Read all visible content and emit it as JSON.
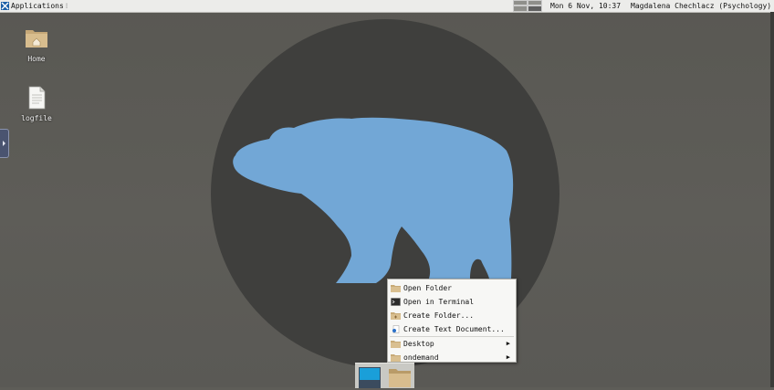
{
  "panel": {
    "applications_label": "Applications",
    "menu_dots": "⁝",
    "clock": "Mon  6 Nov, 10:37",
    "user": "Magdalena Chechlacz (Psychology)"
  },
  "desktop": {
    "icons": [
      {
        "label": "Home",
        "icon": "home-folder-icon"
      },
      {
        "label": "logfile",
        "icon": "text-file-icon"
      }
    ],
    "wallpaper": {
      "circle_color": "#3f3f3d",
      "bear_color": "#72a7d6"
    }
  },
  "context_menu": {
    "items": [
      {
        "label": "Open Folder",
        "icon": "folder-icon"
      },
      {
        "label": "Open in Terminal",
        "icon": "terminal-icon"
      },
      {
        "label": "Create Folder...",
        "icon": "new-folder-icon"
      },
      {
        "label": "Create Text Document...",
        "icon": "new-document-icon"
      },
      {
        "label": "Desktop",
        "icon": "folder-icon",
        "submenu": true
      },
      {
        "label": "ondemand",
        "icon": "folder-icon",
        "submenu": true
      }
    ],
    "submenu_arrow": "▶"
  },
  "dock": {
    "items": [
      {
        "icon": "desktop-show-icon"
      },
      {
        "icon": "file-manager-folder-icon"
      }
    ]
  },
  "colors": {
    "panel_bg": "#ececea",
    "desktop_bg": "#5e5d58",
    "accent_blue": "#1a9fd9"
  }
}
